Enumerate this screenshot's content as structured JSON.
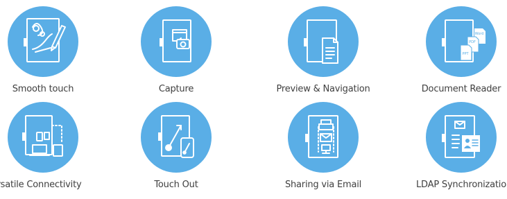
{
  "features": [
    {
      "label": "Smooth touch",
      "icon": "smooth-touch-icon"
    },
    {
      "label": "Capture",
      "icon": "capture-icon"
    },
    {
      "label": "Preview & Navigation",
      "icon": "preview-navigation-icon"
    },
    {
      "label": "Document Reader",
      "icon": "document-reader-icon",
      "doc_labels": [
        "Word",
        "PDF",
        "PPT"
      ]
    },
    {
      "label": "Versatile Connectivity",
      "icon": "versatile-connectivity-icon"
    },
    {
      "label": "Touch Out",
      "icon": "touch-out-icon"
    },
    {
      "label": "Sharing via Email",
      "icon": "sharing-via-email-icon"
    },
    {
      "label": "LDAP Synchronization",
      "icon": "ldap-synchronization-icon"
    }
  ],
  "colors": {
    "circle": "#5aaee6",
    "label": "#3f3f3f",
    "icon_line": "#ffffff"
  }
}
